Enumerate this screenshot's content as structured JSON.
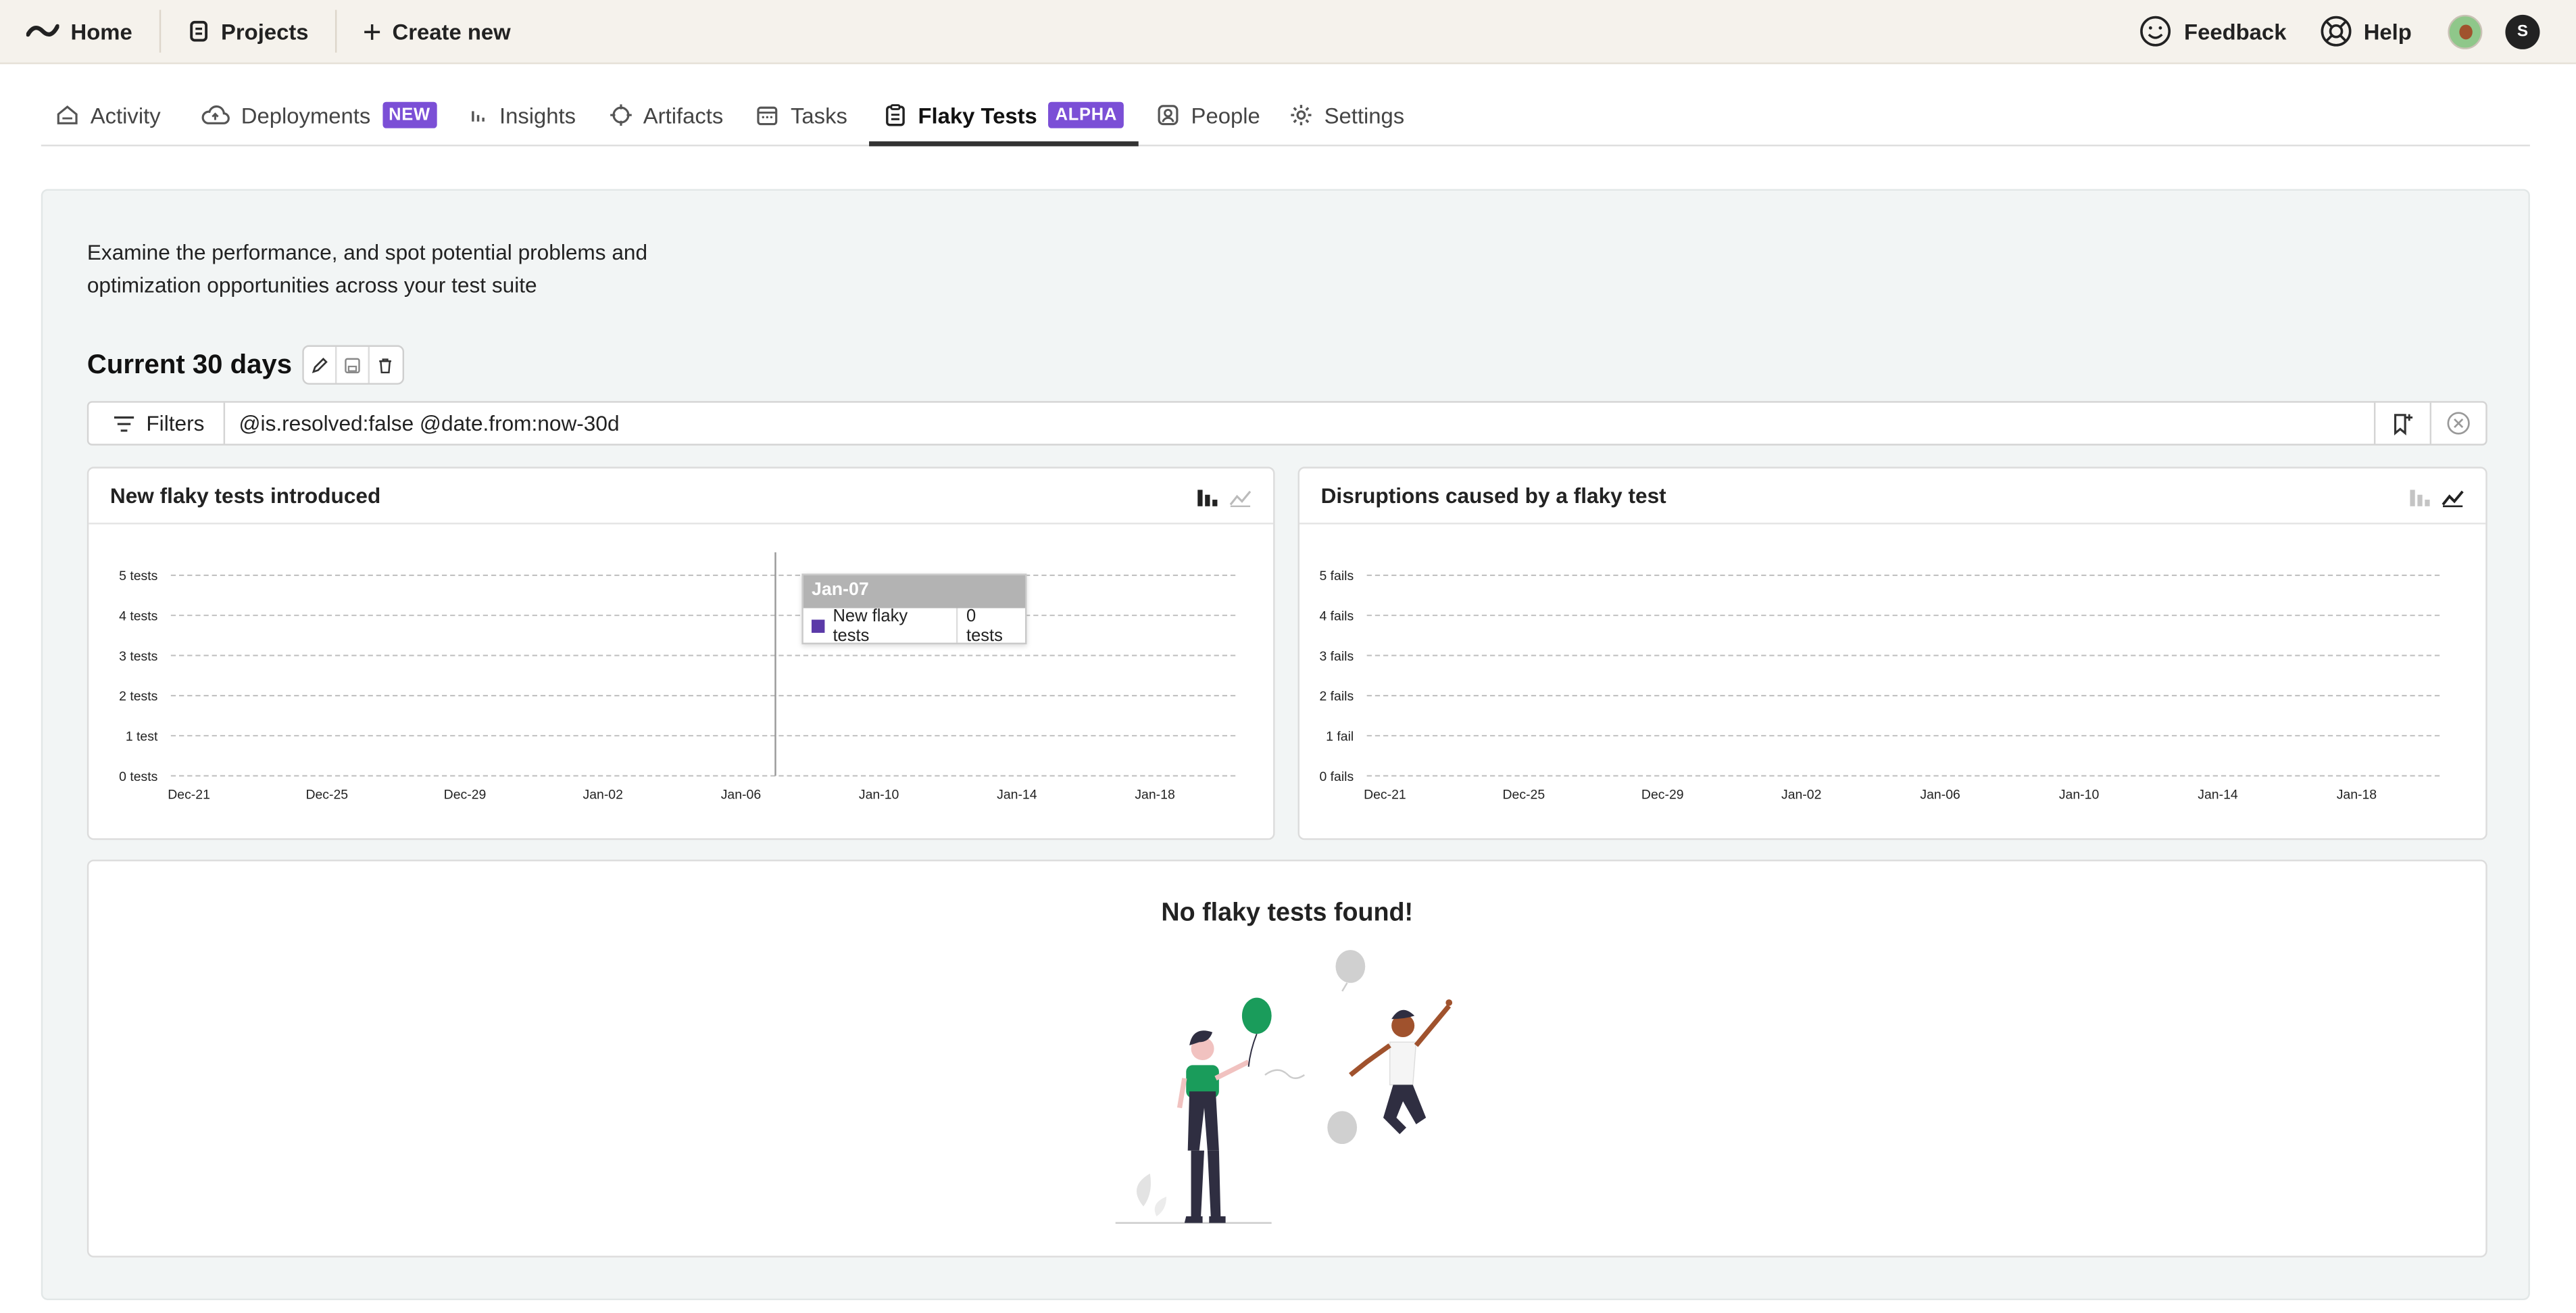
{
  "topbar": {
    "home": "Home",
    "projects": "Projects",
    "create_new": "Create new",
    "feedback": "Feedback",
    "help": "Help",
    "user_initial": "S"
  },
  "tabs": [
    {
      "label": "Activity",
      "icon": "home-icon"
    },
    {
      "label": "Deployments",
      "icon": "cloud-icon",
      "badge": "NEW"
    },
    {
      "label": "Insights",
      "icon": "bar-chart-icon"
    },
    {
      "label": "Artifacts",
      "icon": "artifact-icon"
    },
    {
      "label": "Tasks",
      "icon": "calendar-icon"
    },
    {
      "label": "Flaky Tests",
      "icon": "clipboard-icon",
      "badge": "ALPHA",
      "active": true
    },
    {
      "label": "People",
      "icon": "person-icon"
    },
    {
      "label": "Settings",
      "icon": "gear-icon"
    }
  ],
  "description": {
    "line1": "Examine the performance, and spot potential problems and",
    "line2": "optimization opportunities across your test suite"
  },
  "view": {
    "title": "Current 30 days"
  },
  "filters": {
    "label": "Filters",
    "query": "@is.resolved:false @date.from:now-30d"
  },
  "colors": {
    "accent": "#7b4fd6",
    "series": "#5b3aa8",
    "green_balloon": "#1a9c5b"
  },
  "chart_data": [
    {
      "type": "bar",
      "title": "New flaky tests introduced",
      "x_ticks": [
        "Dec-21",
        "Dec-25",
        "Dec-29",
        "Jan-02",
        "Jan-06",
        "Jan-10",
        "Jan-14",
        "Jan-18"
      ],
      "y_ticks": [
        "0 tests",
        "1 test",
        "2 tests",
        "3 tests",
        "4 tests",
        "5 tests"
      ],
      "ylim": [
        0,
        5
      ],
      "grid": true,
      "series": [
        {
          "name": "New flaky tests",
          "values": []
        }
      ],
      "tooltip": {
        "date": "Jan-07",
        "series": "New flaky tests",
        "value": "0 tests"
      }
    },
    {
      "type": "line",
      "title": "Disruptions caused by a flaky test",
      "x_ticks": [
        "Dec-21",
        "Dec-25",
        "Dec-29",
        "Jan-02",
        "Jan-06",
        "Jan-10",
        "Jan-14",
        "Jan-18"
      ],
      "y_ticks": [
        "0 fails",
        "1 fail",
        "2 fails",
        "3 fails",
        "4 fails",
        "5 fails"
      ],
      "ylim": [
        0,
        5
      ],
      "grid": true,
      "series": []
    }
  ],
  "empty_state": {
    "title": "No flaky tests found!"
  }
}
